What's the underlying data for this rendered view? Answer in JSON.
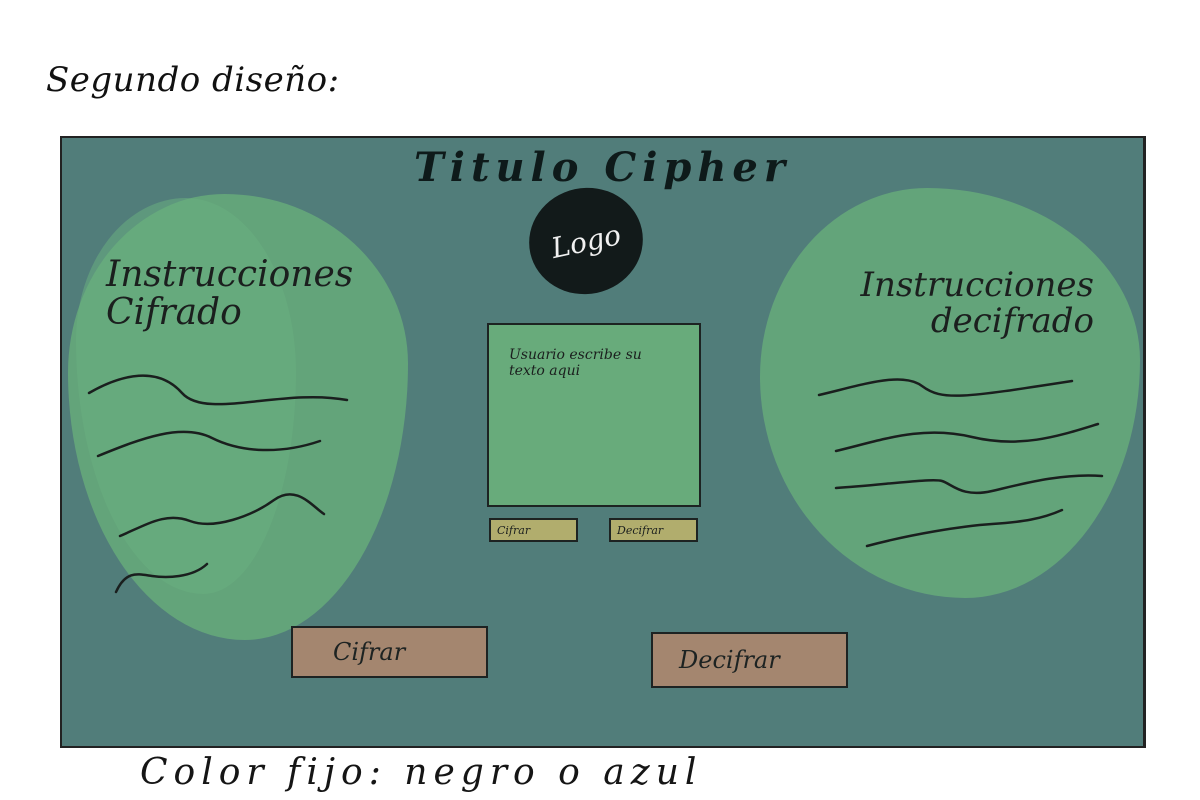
{
  "heading": "Segundo diseño:",
  "app": {
    "title": "Titulo Cipher",
    "logo": "Logo"
  },
  "instructions": {
    "encrypt_title": "Instrucciones Cifrado",
    "decrypt_title": "Instrucciones decifrado"
  },
  "input": {
    "placeholder": "Usuario escribe su texto aqui"
  },
  "small_buttons": {
    "encrypt": "Cifrar",
    "decrypt": "Decifrar"
  },
  "large_buttons": {
    "encrypt": "Cifrar",
    "decrypt": "Decifrar"
  },
  "note": "Color fijo: negro o azul",
  "colors": {
    "background": "#517d7a",
    "instruction_panels": "#64a57a",
    "text_area": "#68ab7b",
    "small_buttons": "#b1ad6d",
    "large_buttons": "#a4866f",
    "logo": "#121a1a"
  },
  "icons": [
    "logo-circle"
  ]
}
